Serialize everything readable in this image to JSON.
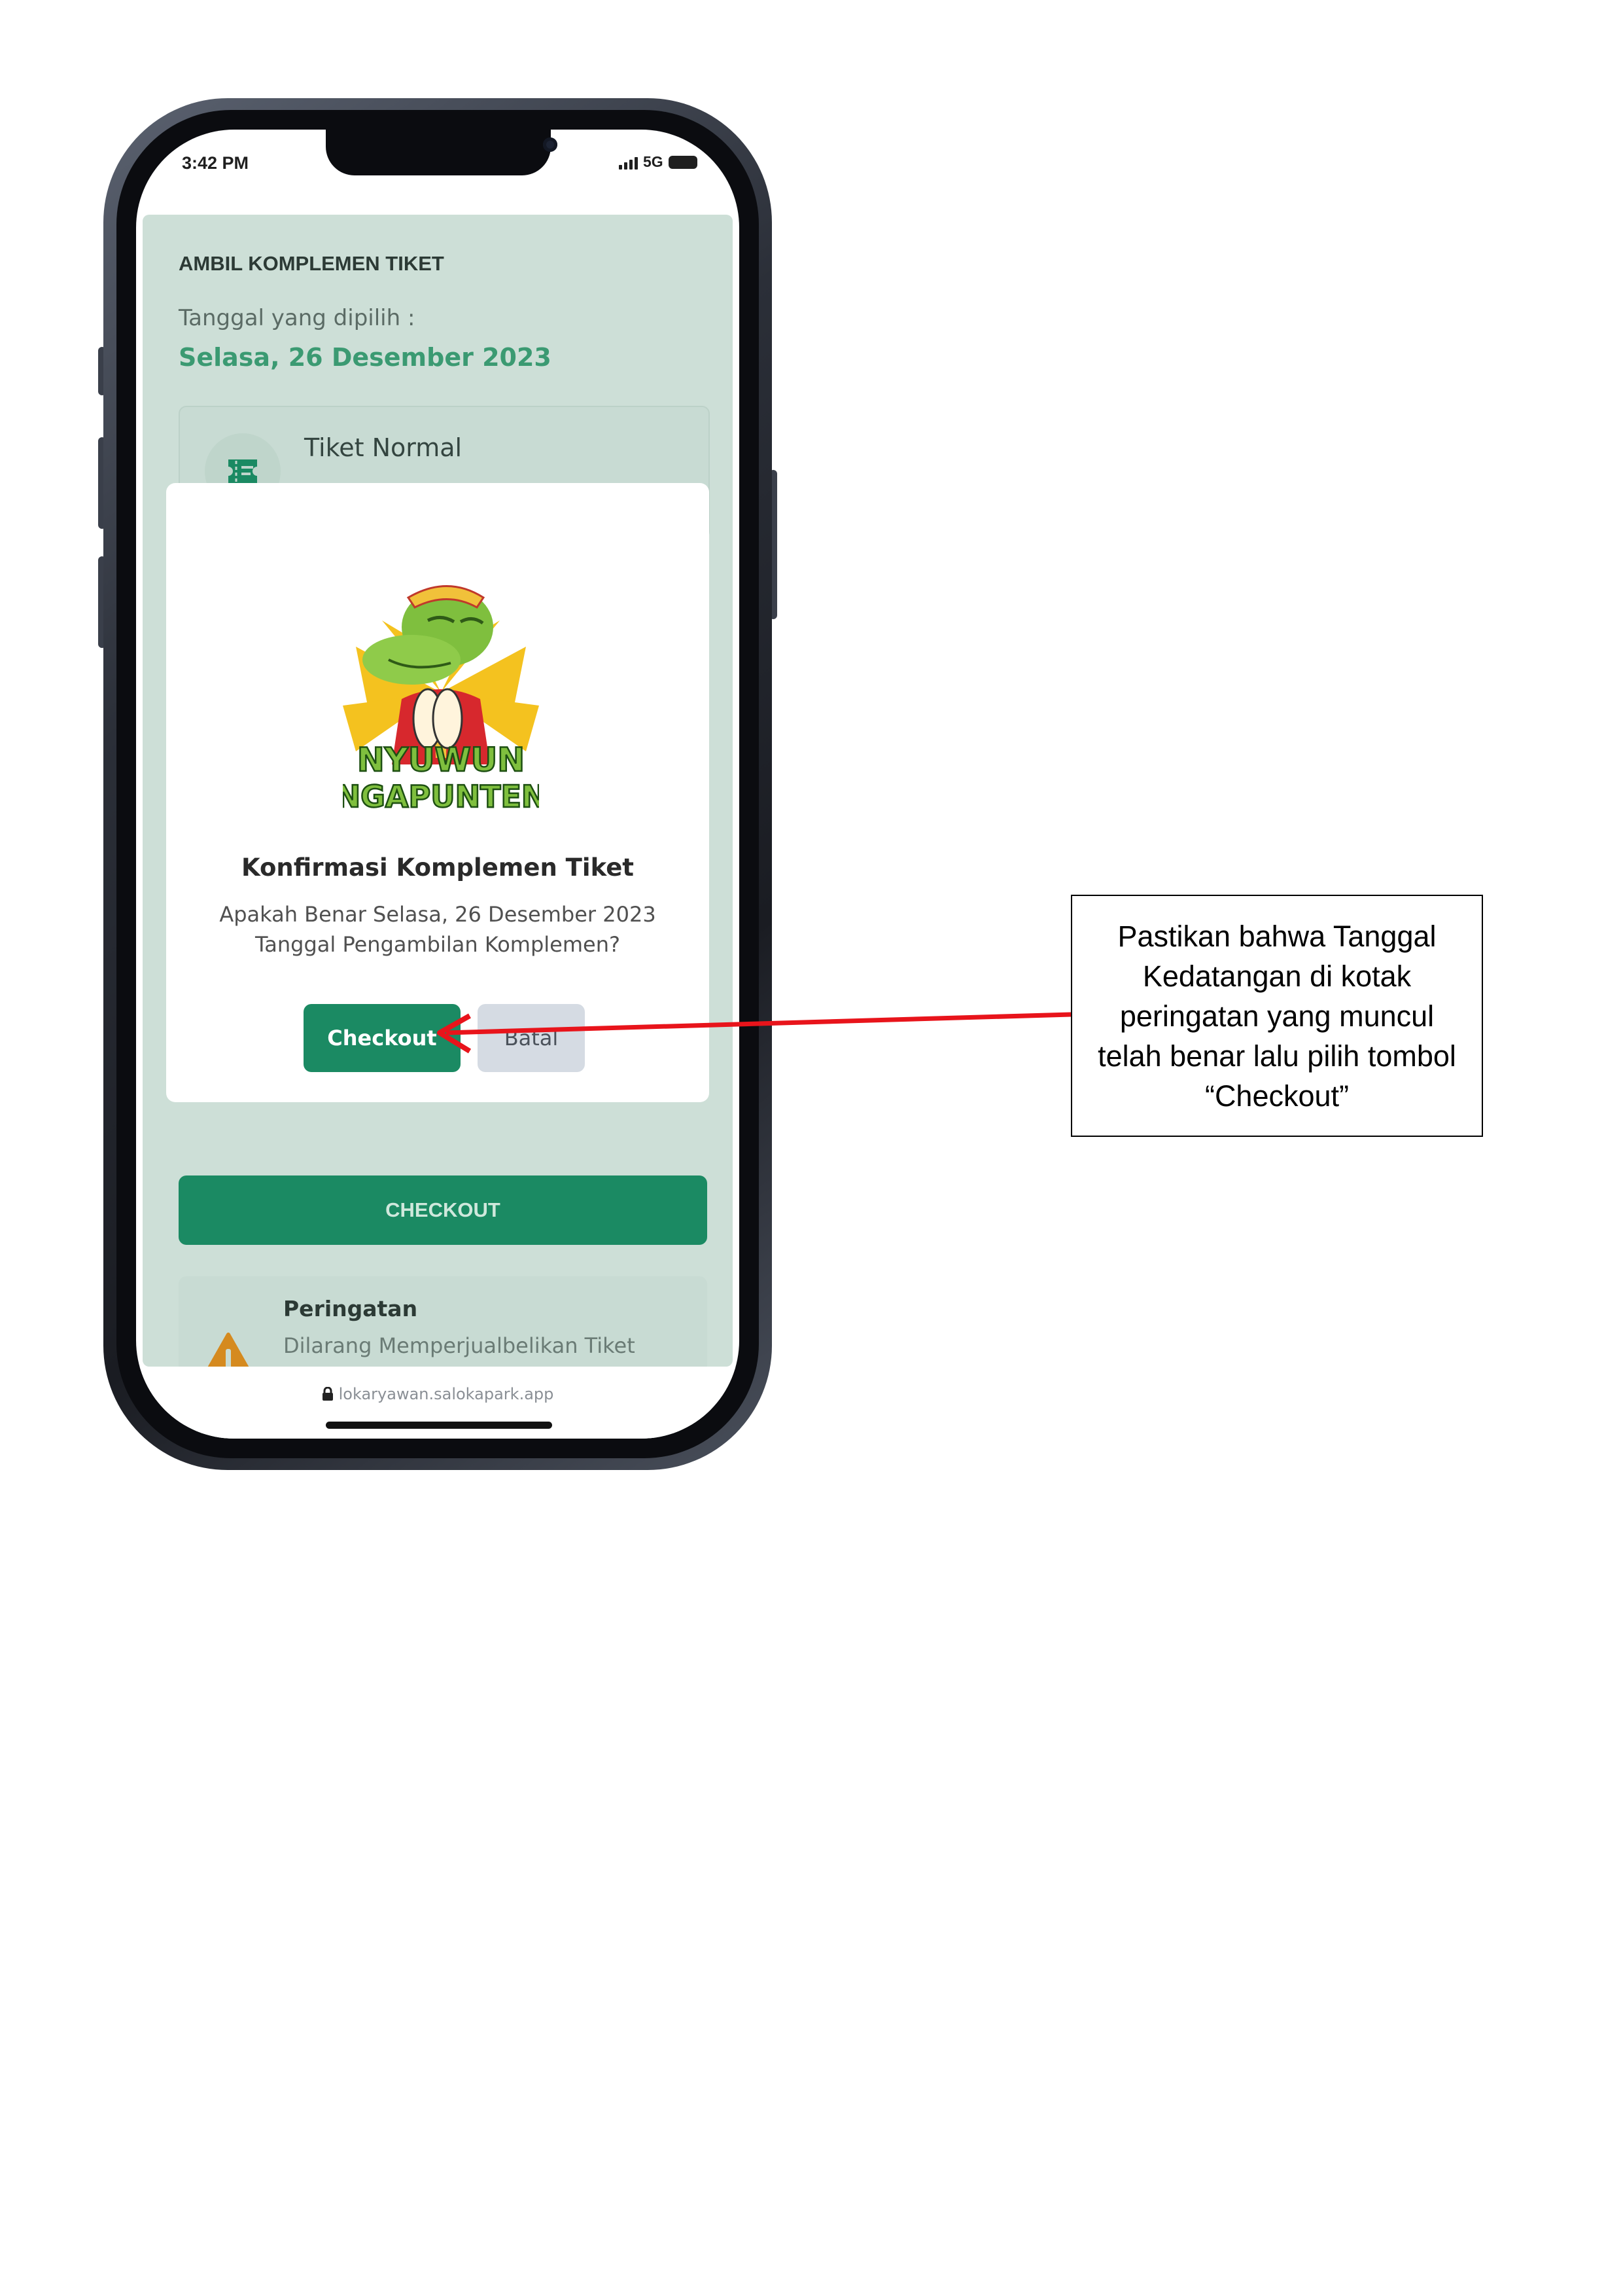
{
  "status_bar": {
    "time": "3:42 PM",
    "network": "5G"
  },
  "page": {
    "header": "AMBIL KOMPLEMEN TIKET",
    "date_label": "Tanggal yang dipilih :",
    "date_value": "Selasa, 26 Desember 2023",
    "ticket_label": "Tiket Normal",
    "checkout_label": "CHECKOUT",
    "warning_title": "Peringatan",
    "warning_text": "Dilarang Memperjualbelikan Tiket Komplemen. Segala Bentuk Pelanggaran Akan Ditindak Tegas!"
  },
  "modal": {
    "mascot_caption_line1": "NYUWUN",
    "mascot_caption_line2": "NGAPUNTEN",
    "title": "Konfirmasi Komplemen Tiket",
    "message": "Apakah Benar Selasa, 26 Desember 2023 Tanggal Pengambilan Komplemen?",
    "confirm_label": "Checkout",
    "cancel_label": "Batal"
  },
  "browser": {
    "url": "lokaryawan.salokapark.app"
  },
  "annotation": {
    "text": "Pastikan bahwa Tanggal Kedatangan di kotak peringatan yang muncul telah benar lalu pilih tombol “Checkout”",
    "arrow_color": "#e8141b"
  },
  "colors": {
    "primary_green": "#1b8a63",
    "date_green": "#3b9a72",
    "background_tint": "#cddfd7",
    "warning_orange": "#d58a1f"
  }
}
